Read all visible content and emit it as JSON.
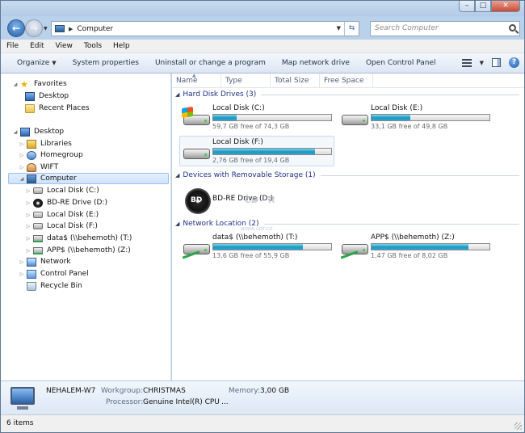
{
  "window": {
    "controls": [
      "minimize",
      "maximize",
      "close"
    ]
  },
  "address": {
    "path": "Computer",
    "search_placeholder": "Search Computer"
  },
  "menu": [
    "File",
    "Edit",
    "View",
    "Tools",
    "Help"
  ],
  "commands": [
    "Organize",
    "System properties",
    "Uninstall or change a program",
    "Map network drive",
    "Open Control Panel"
  ],
  "nav": {
    "favorites": {
      "label": "Favorites",
      "items": [
        "Desktop",
        "Recent Places"
      ]
    },
    "desktop": "Desktop",
    "libraries": "Libraries",
    "homegroup": "Homegroup",
    "user": "WIFT",
    "computer": "Computer",
    "computer_items": [
      "Local Disk (C:)",
      "BD-RE Drive (D:)",
      "Local Disk (E:)",
      "Local Disk (F:)",
      "data$ (\\\\behemoth) (T:)",
      "APP$ (\\\\behemoth) (Z:)"
    ],
    "network": "Network",
    "control_panel": "Control Panel",
    "recycle_bin": "Recycle Bin"
  },
  "columns": [
    "Name",
    "Type",
    "Total Size",
    "Free Space"
  ],
  "groups": {
    "hdd": "Hard Disk Drives (3)",
    "removable": "Devices with Removable Storage (1)",
    "network": "Network Location (2)"
  },
  "drives": {
    "c": {
      "name": "Local Disk (C:)",
      "free": "59,7 GB free of 74,3 GB",
      "used_fraction": 0.2
    },
    "e": {
      "name": "Local Disk (E:)",
      "free": "33,1 GB free of 49,8 GB",
      "used_fraction": 0.33
    },
    "f": {
      "name": "Local Disk (F:)",
      "free": "2,76 GB free of 19,4 GB",
      "used_fraction": 0.86
    },
    "d": {
      "name": "BD-RE Drive (D:)"
    },
    "t": {
      "name": "data$ (\\\\behemoth) (T:)",
      "free": "13,6 GB free of 55,9 GB",
      "used_fraction": 0.76
    },
    "z": {
      "name": "APP$ (\\\\behemoth) (Z:)",
      "free": "1,47 GB free of 8,02 GB",
      "used_fraction": 0.82
    }
  },
  "watermark": {
    "logo": "CD - R",
    "url": "www.cdr.cz"
  },
  "details": {
    "pc_name": "NEHALEM-W7",
    "workgroup_label": "Workgroup:",
    "workgroup": "CHRISTMAS",
    "memory_label": "Memory:",
    "memory": "3,00 GB",
    "processor_label": "Processor:",
    "processor": "Genuine Intel(R) CPU",
    "processor_more": "..."
  },
  "status": {
    "items": "6 items"
  }
}
